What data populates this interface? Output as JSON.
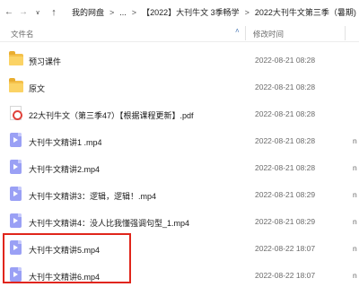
{
  "toolbar": {
    "back_icon": "arrow-left-icon",
    "forward_icon": "arrow-right-icon",
    "dropdown_icon": "chevron-down-icon",
    "up_icon": "arrow-up-icon",
    "breadcrumbs": [
      "我的网盘",
      "...",
      "【2022】大刊牛文 3季畅学",
      "2022大刊牛文第三季（暑期)"
    ],
    "separator": ">"
  },
  "columns": {
    "name": "文件名",
    "sort_icon": "sort-up-icon",
    "date": "修改时间"
  },
  "files": [
    {
      "icon": "folder-icon",
      "name": "预习课件",
      "date": "2022-08-21 08:28",
      "type": ""
    },
    {
      "icon": "folder-icon",
      "name": "原文",
      "date": "2022-08-21 08:28",
      "type": ""
    },
    {
      "icon": "pdf-icon",
      "name": "22大刊牛文（第三季47）【根据课程更新】.pdf",
      "date": "2022-08-21 08:28",
      "type": ""
    },
    {
      "icon": "video-icon",
      "name": "大刊牛文精讲1 .mp4",
      "date": "2022-08-21 08:28",
      "type": "n"
    },
    {
      "icon": "video-icon",
      "name": "大刊牛文精讲2.mp4",
      "date": "2022-08-21 08:28",
      "type": "n"
    },
    {
      "icon": "video-icon",
      "name": "大刊牛文精讲3：逻辑，逻辑！.mp4",
      "date": "2022-08-21 08:29",
      "type": "n"
    },
    {
      "icon": "video-icon",
      "name": "大刊牛文精讲4：没人比我懂强调句型_1.mp4",
      "date": "2022-08-21 08:29",
      "type": "n"
    },
    {
      "icon": "video-icon",
      "name": "大刊牛文精讲5.mp4",
      "date": "2022-08-22 18:07",
      "type": "n"
    },
    {
      "icon": "video-icon",
      "name": "大刊牛文精讲6.mp4",
      "date": "2022-08-22 18:07",
      "type": "n"
    }
  ],
  "colors": {
    "folder": "#f4c04a",
    "video": "#9aa0f5",
    "pdf": "#e0413a",
    "highlight_box": "#e0251b",
    "sort_arrow": "#4a78b5"
  }
}
